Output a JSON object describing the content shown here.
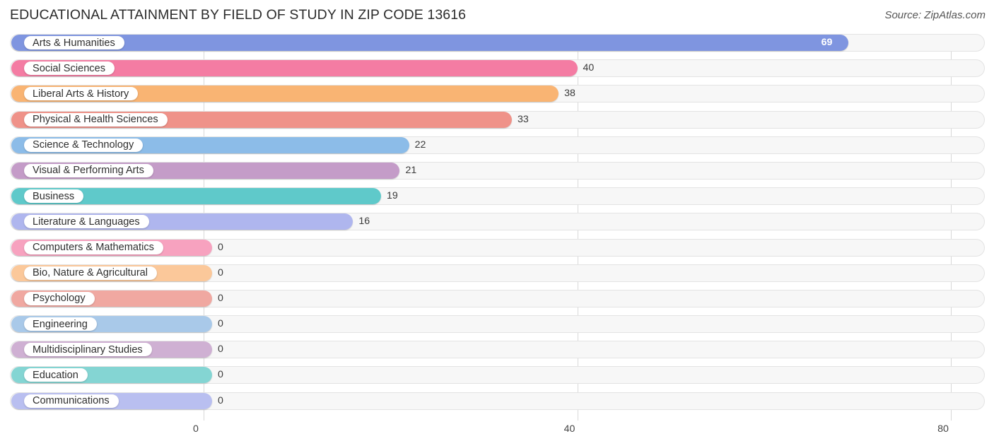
{
  "header": {
    "title": "EDUCATIONAL ATTAINMENT BY FIELD OF STUDY IN ZIP CODE 13616",
    "source": "Source: ZipAtlas.com"
  },
  "chart_data": {
    "type": "bar",
    "orientation": "horizontal",
    "title": "EDUCATIONAL ATTAINMENT BY FIELD OF STUDY IN ZIP CODE 13616",
    "xlabel": "",
    "ylabel": "",
    "xlim": [
      0,
      80
    ],
    "xticks": [
      0,
      40,
      80
    ],
    "xtick_labels": [
      "0",
      "40",
      "80"
    ],
    "grid": true,
    "legend": false,
    "categories": [
      "Arts & Humanities",
      "Social Sciences",
      "Liberal Arts & History",
      "Physical & Health Sciences",
      "Science & Technology",
      "Visual & Performing Arts",
      "Business",
      "Literature & Languages",
      "Computers & Mathematics",
      "Bio, Nature & Agricultural",
      "Psychology",
      "Engineering",
      "Multidisciplinary Studies",
      "Education",
      "Communications"
    ],
    "values": [
      69,
      40,
      38,
      33,
      22,
      21,
      19,
      16,
      0,
      0,
      0,
      0,
      0,
      0,
      0
    ],
    "value_labels": [
      "69",
      "40",
      "38",
      "33",
      "22",
      "21",
      "19",
      "16",
      "0",
      "0",
      "0",
      "0",
      "0",
      "0",
      "0"
    ],
    "colors": [
      "#7f95e0",
      "#f47ca3",
      "#f9b473",
      "#ef9289",
      "#8cbce8",
      "#c49cc8",
      "#5fc9ca",
      "#afb6ee",
      "#f7a2bf",
      "#fbc89a",
      "#f0a8a1",
      "#a9c9e9",
      "#cfb0d3",
      "#84d5d3",
      "#b9bff0"
    ]
  }
}
